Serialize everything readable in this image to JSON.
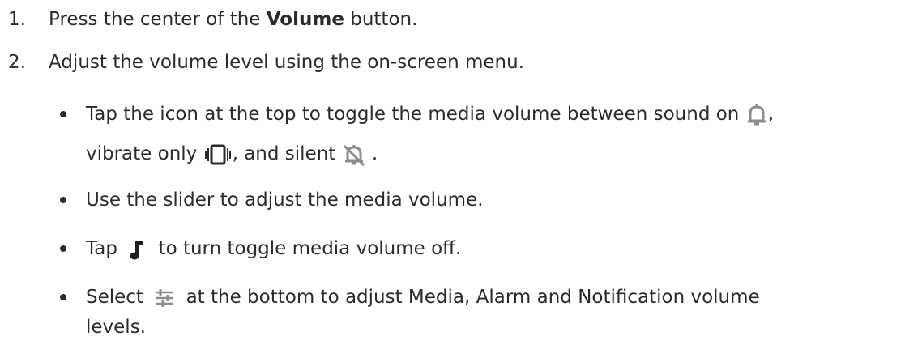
{
  "steps": [
    {
      "number": "1.",
      "text_before": "Press the center of the ",
      "bold": "Volume",
      "text_after": " button."
    },
    {
      "number": "2.",
      "text": "Adjust the volume level using the on-screen menu."
    }
  ],
  "bullets": [
    {
      "line1_a": "Tap  the icon at the top to toggle the media volume between sound on ",
      "line1_b": ",",
      "line2_a": "vibrate only ",
      "line2_b": ", and silent ",
      "line2_c": " .",
      "icons": [
        "bell-icon",
        "vibrate-icon",
        "bell-off-icon"
      ]
    },
    {
      "text": "Use the slider to adjust the media volume."
    },
    {
      "text_a": "Tap ",
      "text_b": " to turn toggle media volume off.",
      "icons": [
        "music-note-icon"
      ]
    },
    {
      "line1_a": "Select ",
      "line1_b": " at the bottom to adjust Media, Alarm and Notification volume",
      "line2": "levels.",
      "icons": [
        "equalizer-icon"
      ]
    }
  ],
  "colors": {
    "text": "#2b2b2b",
    "icon_gray": "#8c8c8c"
  }
}
